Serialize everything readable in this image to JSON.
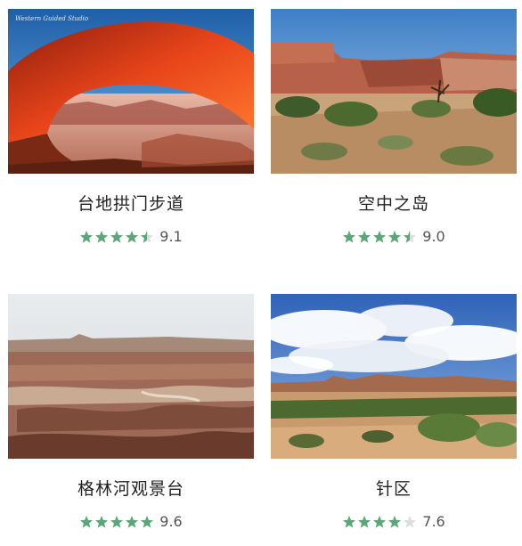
{
  "colors": {
    "star_filled": "#5aa777",
    "star_empty": "#dddddd",
    "title": "#222222",
    "score": "#555555"
  },
  "cards": [
    {
      "title": "台地拱门步道",
      "score": "9.1",
      "rating": 4.5,
      "image": "mesa-arch-sunrise",
      "watermark": "Western Guided Studio"
    },
    {
      "title": "空中之岛",
      "score": "9.0",
      "rating": 4.5,
      "image": "island-in-the-sky-canyon-shrubs"
    },
    {
      "title": "格林河观景台",
      "score": "9.6",
      "rating": 5,
      "image": "green-river-overlook"
    },
    {
      "title": "针区",
      "score": "7.6",
      "rating": 4,
      "image": "needles-district-clouds"
    }
  ]
}
